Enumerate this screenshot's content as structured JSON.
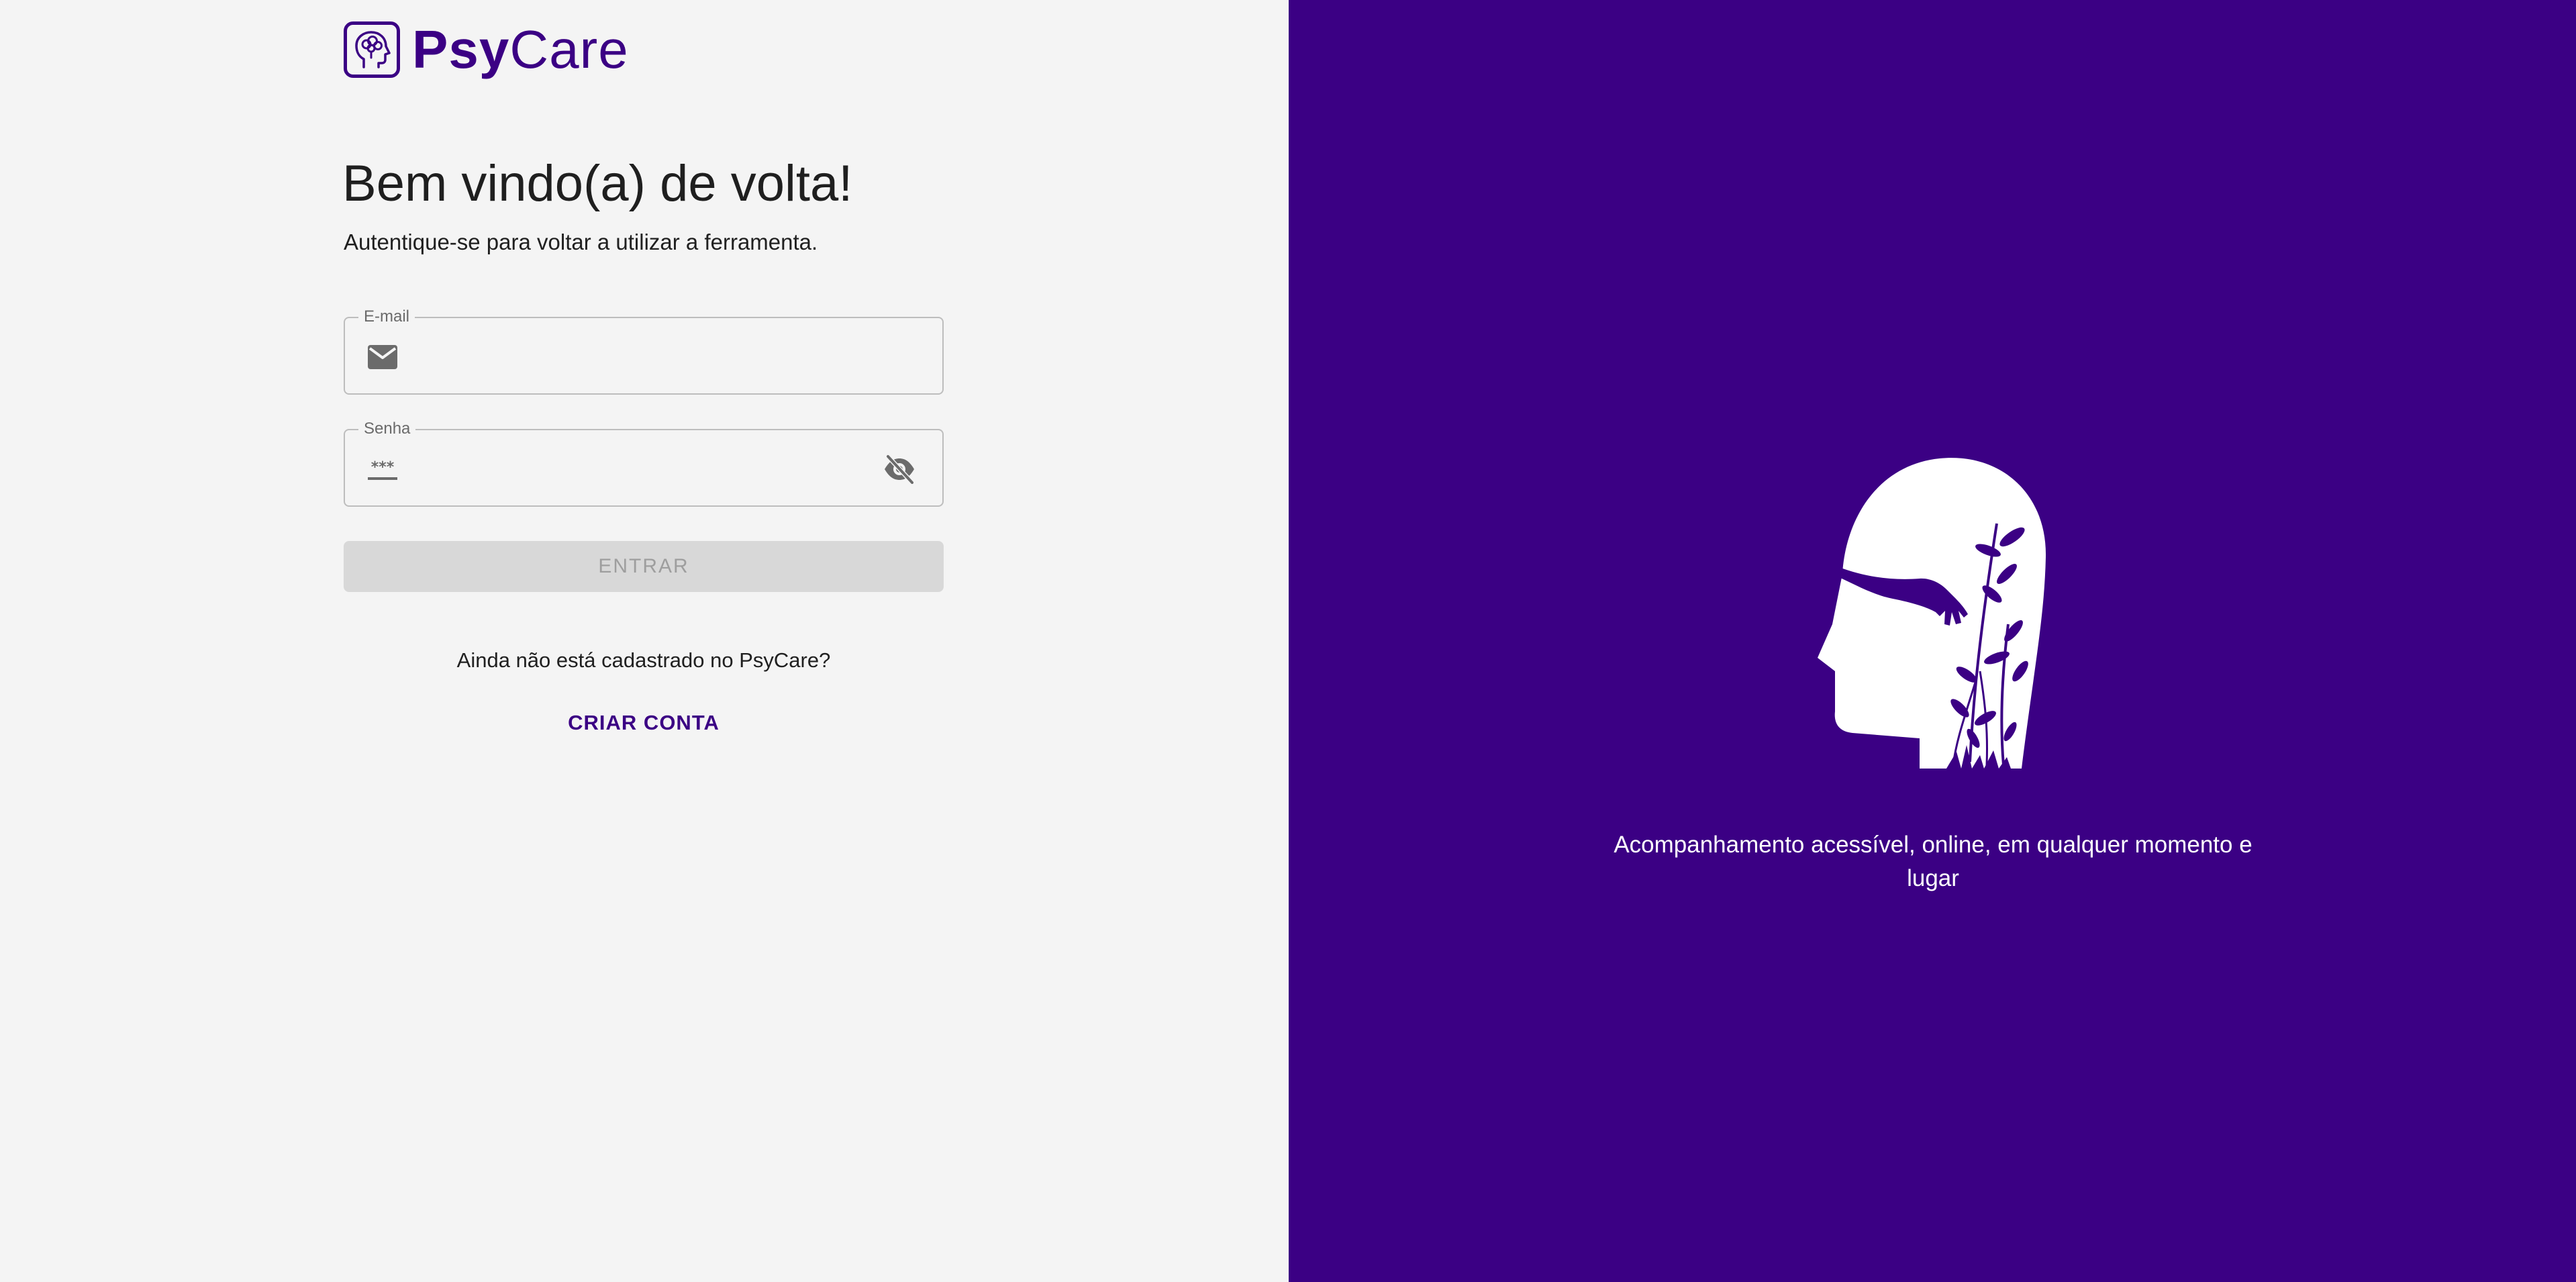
{
  "brand": {
    "name_part1": "Psy",
    "name_part2": "Care",
    "logo_icon": "head-brain-icon",
    "primary_color": "#3b0084"
  },
  "login": {
    "title": "Bem vindo(a) de volta!",
    "subtitle": "Autentique-se para voltar a utilizar a ferramenta.",
    "email": {
      "label": "E-mail",
      "value": "",
      "placeholder": "",
      "icon": "mail-icon"
    },
    "password": {
      "label": "Senha",
      "value": "",
      "placeholder": "",
      "icon": "password-icon",
      "toggle_icon": "eye-off-icon"
    },
    "submit_label": "ENTRAR",
    "signup_question": "Ainda não está cadastrado no PsyCare?",
    "signup_link": "CRIAR CONTA"
  },
  "hero": {
    "illustration": "head-with-plants-illustration",
    "tagline": "Acompanhamento acessível, online, em qualquer momento e lugar"
  }
}
